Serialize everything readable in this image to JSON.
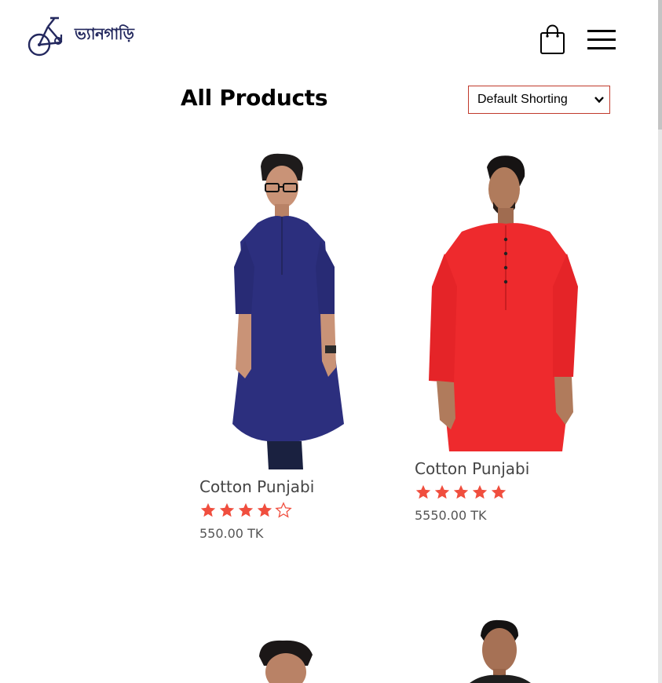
{
  "header": {
    "logo_text": "ভ্যানগাড়ি",
    "cart_icon": "shopping-bag-icon",
    "menu_icon": "hamburger-menu-icon"
  },
  "main": {
    "title": "All Products",
    "sort": {
      "selected": "Default Shorting",
      "options": [
        "Default Shorting"
      ]
    }
  },
  "colors": {
    "brand": "#23285e",
    "star": "#f04e3e",
    "select_border": "#c0392b",
    "title": "#000000",
    "price": "#555555"
  },
  "products": [
    {
      "name": "Cotton Punjabi",
      "rating": 4,
      "max_rating": 5,
      "price": "550.00 TK",
      "image": "navy-blue-punjabi-photo",
      "color": "#2c2f7e"
    },
    {
      "name": "Cotton Punjabi",
      "rating": 5,
      "max_rating": 5,
      "price": "5550.00 TK",
      "image": "red-punjabi-photo",
      "color": "#ee2a2d"
    },
    {
      "image": "man-portrait-photo-partial"
    },
    {
      "image": "man-portrait-photo-partial"
    }
  ]
}
